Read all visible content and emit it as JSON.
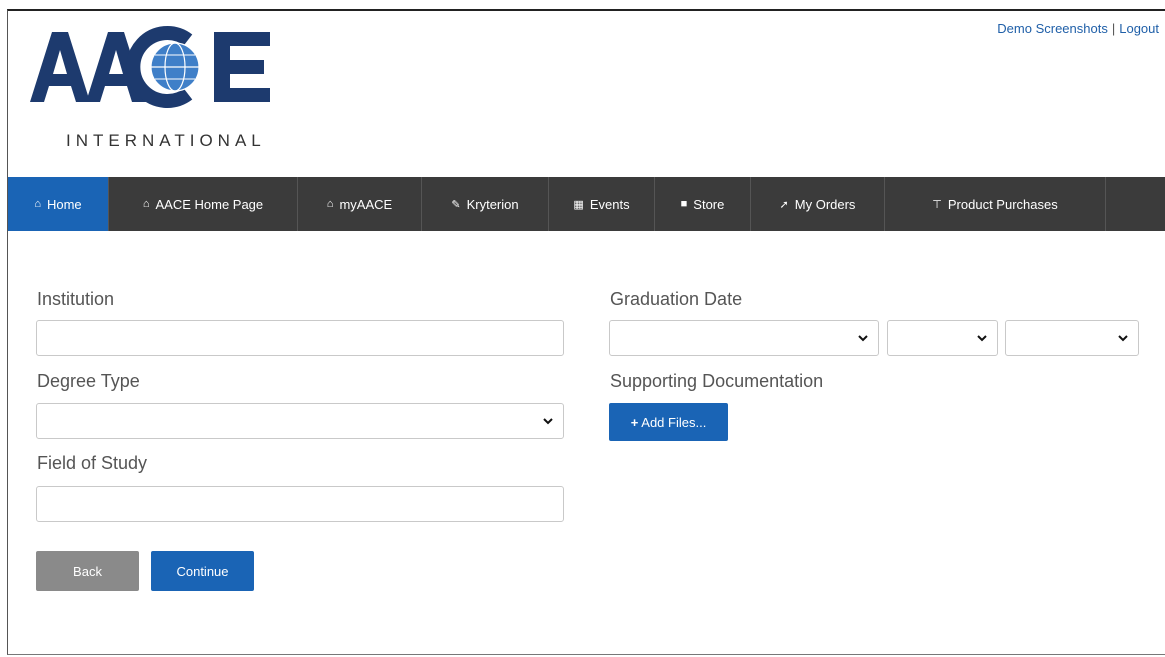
{
  "header": {
    "links": [
      "Demo Screenshots",
      "Logout"
    ],
    "logo_text": "AACE",
    "logo_subtext": "INTERNATIONAL"
  },
  "nav": {
    "items": [
      {
        "label": "Home",
        "icon": "home-icon",
        "active": true
      },
      {
        "label": "AACE Home Page",
        "icon": "home-icon"
      },
      {
        "label": "myAACE",
        "icon": "home-icon"
      },
      {
        "label": "Kryterion",
        "icon": "edit-icon"
      },
      {
        "label": "Events",
        "icon": "calendar-icon"
      },
      {
        "label": "Store",
        "icon": "cart-icon"
      },
      {
        "label": "My Orders",
        "icon": "pin-icon"
      },
      {
        "label": "Product Purchases",
        "icon": "filter-icon"
      }
    ]
  },
  "form": {
    "institution_label": "Institution",
    "institution_value": "",
    "degree_type_label": "Degree Type",
    "degree_type_value": "",
    "field_of_study_label": "Field of Study",
    "field_of_study_value": "",
    "graduation_date_label": "Graduation Date",
    "graduation_month_value": "",
    "graduation_day_value": "",
    "graduation_year_value": "",
    "supporting_docs_label": "Supporting Documentation",
    "add_files_label": "Add Files..."
  },
  "actions": {
    "back_label": "Back",
    "continue_label": "Continue"
  },
  "colors": {
    "brand_blue": "#1a64b5",
    "logo_navy": "#1d3a6e",
    "nav_bg": "#3b3b3b",
    "back_gray": "#8a8a8a"
  }
}
